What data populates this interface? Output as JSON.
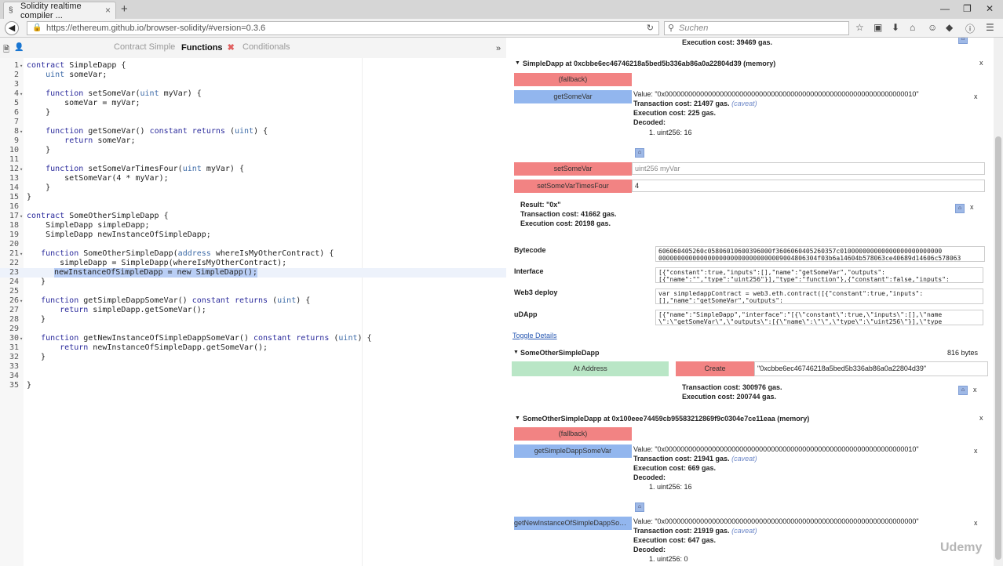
{
  "browser": {
    "tab_title": "Solidity realtime compiler ...",
    "tab_close": "×",
    "new_tab": "+",
    "url": "https://ethereum.github.io/browser-solidity/#version=0.3.6",
    "search_placeholder": "Suchen",
    "window_min": "—",
    "window_max": "❐",
    "window_close": "✕"
  },
  "editor": {
    "tabs": [
      {
        "label": "Contract Simple"
      },
      {
        "label": "Functions",
        "close": "✖"
      },
      {
        "label": "Conditionals"
      }
    ],
    "collapse": "»",
    "lines": [
      {
        "n": "1",
        "code": "contract SimpleDapp {",
        "fold": true
      },
      {
        "n": "2",
        "code": "    uint someVar;"
      },
      {
        "n": "3",
        "code": ""
      },
      {
        "n": "4",
        "code": "    function setSomeVar(uint myVar) {",
        "fold": true
      },
      {
        "n": "5",
        "code": "        someVar = myVar;"
      },
      {
        "n": "6",
        "code": "    }"
      },
      {
        "n": "7",
        "code": ""
      },
      {
        "n": "8",
        "code": "    function getSomeVar() constant returns (uint) {",
        "fold": true
      },
      {
        "n": "9",
        "code": "        return someVar;"
      },
      {
        "n": "10",
        "code": "    }"
      },
      {
        "n": "11",
        "code": ""
      },
      {
        "n": "12",
        "code": "    function setSomeVarTimesFour(uint myVar) {",
        "fold": true
      },
      {
        "n": "13",
        "code": "        setSomeVar(4 * myVar);"
      },
      {
        "n": "14",
        "code": "    }"
      },
      {
        "n": "15",
        "code": "}"
      },
      {
        "n": "16",
        "code": ""
      },
      {
        "n": "17",
        "code": "contract SomeOtherSimpleDapp {",
        "fold": true
      },
      {
        "n": "18",
        "code": "    SimpleDapp simpleDapp;"
      },
      {
        "n": "19",
        "code": "    SimpleDapp newInstanceOfSimpleDapp;"
      },
      {
        "n": "20",
        "code": ""
      },
      {
        "n": "21",
        "code": "   function SomeOtherSimpleDapp(address whereIsMyOtherContract) {",
        "fold": true
      },
      {
        "n": "22",
        "code": "       simpleDapp = SimpleDapp(whereIsMyOtherContract);"
      },
      {
        "n": "23",
        "code": "       newInstanceOfSimpleDapp = new SimpleDapp();",
        "highlight": true
      },
      {
        "n": "24",
        "code": "   }"
      },
      {
        "n": "25",
        "code": ""
      },
      {
        "n": "26",
        "code": "   function getSimpleDappSomeVar() constant returns (uint) {",
        "fold": true
      },
      {
        "n": "27",
        "code": "       return simpleDapp.getSomeVar();"
      },
      {
        "n": "28",
        "code": "   }"
      },
      {
        "n": "29",
        "code": ""
      },
      {
        "n": "30",
        "code": "   function getNewInstanceOfSimpleDappSomeVar() constant returns (uint) {",
        "fold": true
      },
      {
        "n": "31",
        "code": "       return newInstanceOfSimpleDapp.getSomeVar();"
      },
      {
        "n": "32",
        "code": "   }"
      },
      {
        "n": "33",
        "code": ""
      },
      {
        "n": "34",
        "code": ""
      },
      {
        "n": "35",
        "code": "}"
      }
    ]
  },
  "right": {
    "top_exec_cost": "Execution cost: 39469 gas.",
    "instance1": {
      "header": "SimpleDapp at 0xcbbe6ec46746218a5bed5b336ab86a0a22804d39 (memory)",
      "fallback": "(fallback)",
      "getSomeVar": "getSomeVar",
      "value": "Value: \"0x0000000000000000000000000000000000000000000000000000000000000010\"",
      "tx_cost": "Transaction cost: 21497 gas.",
      "caveat": "(caveat)",
      "exec_cost": "Execution cost: 225 gas.",
      "decoded": "Decoded:",
      "decoded_val": "1. uint256: 16",
      "setSomeVar": "setSomeVar",
      "setSomeVar_placeholder": "uint256 myVar",
      "setTimesFour": "setSomeVarTimesFour",
      "setTimesFour_value": "4",
      "result": "Result: \"0x\"",
      "result_tx": "Transaction cost: 41662 gas.",
      "result_exec": "Execution cost: 20198 gas."
    },
    "compile": {
      "bytecode_label": "Bytecode",
      "bytecode": "606060405260c05806010600396000f3606060405260357c010000000000000000000000000\n000000000000000000000000000000009004806304f03b6a14604b578063ce40689d14606c578063",
      "interface_label": "Interface",
      "interface": "[{\"constant\":true,\"inputs\":[],\"name\":\"getSomeVar\",\"outputs\":\n[{\"name\":\"\",\"type\":\"uint256\"}],\"type\":\"function\"},{\"constant\":false,\"inputs\":",
      "web3_label": "Web3 deploy",
      "web3": "var simpledappContract = web3.eth.contract([{\"constant\":true,\"inputs\":\n[],\"name\":\"getSomeVar\",\"outputs\":",
      "udapp_label": "uDApp",
      "udapp": "[{\"name\":\"SimpleDapp\",\"interface\":\"[{\\\"constant\\\":true,\\\"inputs\\\":[],\\\"name\n\\\":\\\"getSomeVar\\\",\\\"outputs\\\":[{\\\"name\\\":\\\"\\\",\\\"type\\\":\\\"uint256\\\"}],\\\"type",
      "toggle": "Toggle Details"
    },
    "contract2": {
      "name": "SomeOtherSimpleDapp",
      "size": "816 bytes",
      "at_address": "At Address",
      "create": "Create",
      "create_value": "\"0xcbbe6ec46746218a5bed5b336ab86a0a22804d39\"",
      "tx_cost": "Transaction cost: 300976 gas.",
      "exec_cost": "Execution cost: 200744 gas."
    },
    "instance2": {
      "header": "SomeOtherSimpleDapp at 0x100eee74459cb95583212869f9c0304e7ce11eaa (memory)",
      "fallback": "(fallback)",
      "getSimple": "getSimpleDappSomeVar",
      "value1": "Value: \"0x0000000000000000000000000000000000000000000000000000000000000010\"",
      "tx1": "Transaction cost: 21941 gas.",
      "caveat": "(caveat)",
      "exec1": "Execution cost: 669 gas.",
      "decoded": "Decoded:",
      "decoded1": "1. uint256: 16",
      "getNew": "getNewInstanceOfSimpleDappSomeVar",
      "value2": "Value: \"0x0000000000000000000000000000000000000000000000000000000000000000\"",
      "tx2": "Transaction cost: 21919 gas.",
      "exec2": "Execution cost: 647 gas.",
      "decoded2": "1. uint256: 0"
    },
    "close": "x",
    "pin": "⌂",
    "triangle": "▼"
  },
  "watermark": "Udemy"
}
